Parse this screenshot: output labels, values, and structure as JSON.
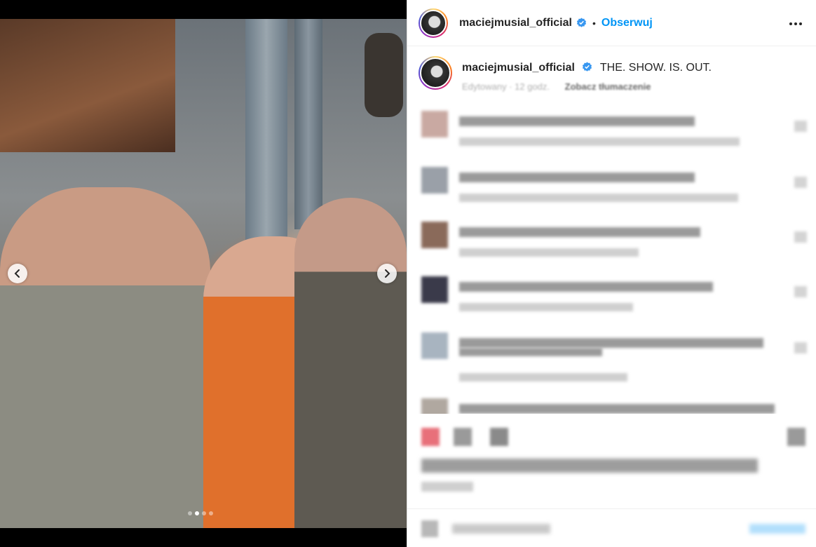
{
  "post": {
    "author": "maciejmusial_official",
    "follow_label": "Obserwuj",
    "separator": "•",
    "caption_text": "THE. SHOW. IS. OUT.",
    "meta_edited": "Edytowany · 12 godz.",
    "meta_translate": "Zobacz tłumaczenie"
  },
  "carousel": {
    "slide_count": 4,
    "active_index": 1
  },
  "colors": {
    "accent": "#0095f6",
    "text": "#262626",
    "muted": "#8e8e8e",
    "verified": "#3897f0"
  },
  "icons": {
    "verified": "verified-badge-icon",
    "more": "more-options-icon",
    "prev": "chevron-left-icon",
    "next": "chevron-right-icon"
  }
}
